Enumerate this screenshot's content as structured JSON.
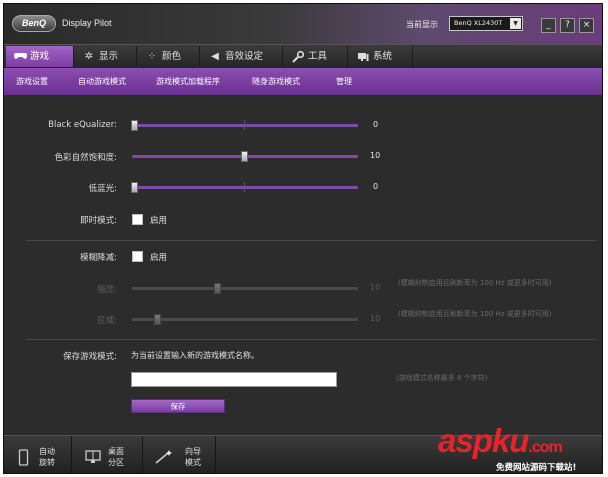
{
  "window": {
    "logo": "BenQ",
    "title": "Display Pilot",
    "monitor_label": "当前显示",
    "monitor_value": "BenQ XL2430T",
    "minimize": "_",
    "help": "?",
    "close": "×"
  },
  "tabs": [
    {
      "label": "游戏",
      "icon": "gamepad-icon",
      "active": true
    },
    {
      "label": "显示",
      "icon": "brightness-icon",
      "active": false
    },
    {
      "label": "颜色",
      "icon": "palette-icon",
      "active": false
    },
    {
      "label": "音效设定",
      "icon": "speaker-icon",
      "active": false
    },
    {
      "label": "工具",
      "icon": "wrench-icon",
      "active": false
    },
    {
      "label": "系统",
      "icon": "system-icon",
      "active": false
    }
  ],
  "subtabs": [
    "游戏设置",
    "自动游戏模式",
    "游戏模式加载程序",
    "随身游戏模式",
    "管理"
  ],
  "settings": {
    "black_equalizer": {
      "label": "Black eQualizer:",
      "value": "0",
      "level": 0
    },
    "saturation": {
      "label": "色彩自然饱和度:",
      "value": "10",
      "level": 0.5
    },
    "low_blue": {
      "label": "低蓝光:",
      "value": "0",
      "level": 0
    },
    "instant_mode": {
      "label": "即时模式:",
      "option": "启用"
    },
    "motion_blur": {
      "label": "模糊降减:",
      "option": "启用"
    },
    "intensity": {
      "label": "强度:",
      "value": "10",
      "level": 0.375,
      "note": "(模糊抑制启用且刷新率为 100 Hz 或更多时可用)"
    },
    "area": {
      "label": "区域:",
      "value": "10",
      "level": 0.1,
      "note": "(模糊抑制启用且刷新率为 100 Hz 或更多时可用)"
    },
    "save_mode": {
      "label": "保存游戏模式:",
      "hint": "为当前设置输入新的游戏模式名称。",
      "limit": "(游戏模式名称最多 8 个字符)",
      "input_value": "",
      "button": "保存"
    }
  },
  "bottom": [
    {
      "label": "自动\n旋转",
      "icon": "rotate-icon"
    },
    {
      "label": "桌面\n分区",
      "icon": "desktop-partition-icon"
    },
    {
      "label": "向导\n模式",
      "icon": "wizard-icon"
    }
  ],
  "watermark": {
    "brand": "aspku",
    "tld": ".com",
    "sub": "免费网站源码下载站!"
  },
  "colors": {
    "accent": "#8b4fb0",
    "background": "#2c2c2c"
  }
}
